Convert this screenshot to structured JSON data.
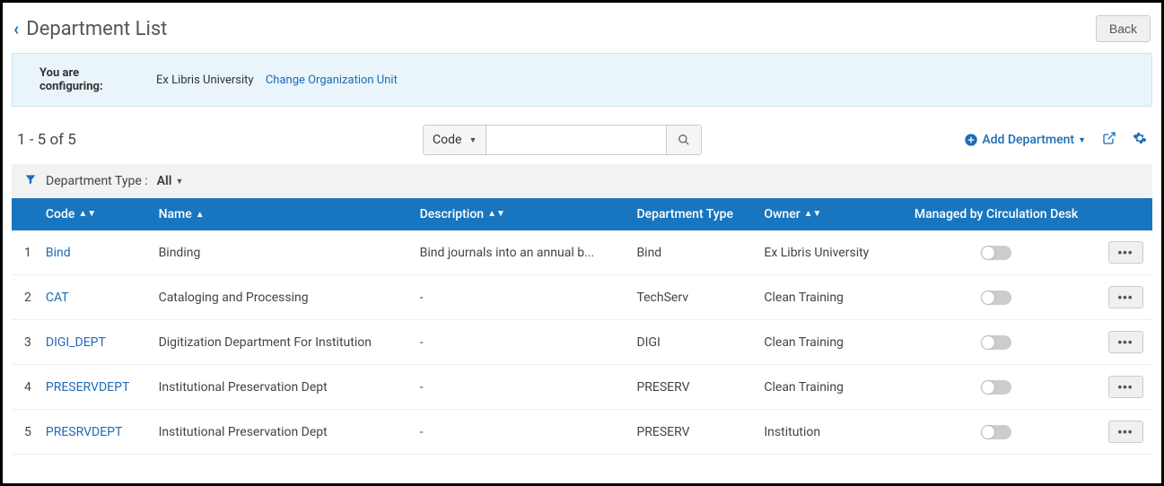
{
  "header": {
    "title": "Department List",
    "back_button": "Back"
  },
  "banner": {
    "label": "You are configuring:",
    "org": "Ex Libris University",
    "change_link": "Change Organization Unit"
  },
  "toolbar": {
    "count": "1 - 5 of 5",
    "search_field_label": "Code",
    "search_value": "",
    "add_label": "Add Department"
  },
  "filter": {
    "label": "Department Type :",
    "value": "All"
  },
  "columns": {
    "code": "Code",
    "name": "Name",
    "description": "Description",
    "dept_type": "Department Type",
    "owner": "Owner",
    "managed": "Managed by Circulation Desk"
  },
  "rows": [
    {
      "idx": "1",
      "code": "Bind",
      "name": "Binding",
      "description": "Bind journals into an annual b...",
      "dept_type": "Bind",
      "owner": "Ex Libris University"
    },
    {
      "idx": "2",
      "code": "CAT",
      "name": "Cataloging and Processing",
      "description": "-",
      "dept_type": "TechServ",
      "owner": "Clean Training"
    },
    {
      "idx": "3",
      "code": "DIGI_DEPT",
      "name": "Digitization Department For Institution",
      "description": "-",
      "dept_type": "DIGI",
      "owner": "Clean Training"
    },
    {
      "idx": "4",
      "code": "PRESERVDEPT",
      "name": "Institutional Preservation Dept",
      "description": "-",
      "dept_type": "PRESERV",
      "owner": "Clean Training"
    },
    {
      "idx": "5",
      "code": "PRESRVDEPT",
      "name": "Institutional Preservation Dept",
      "description": "-",
      "dept_type": "PRESERV",
      "owner": "Institution"
    }
  ]
}
